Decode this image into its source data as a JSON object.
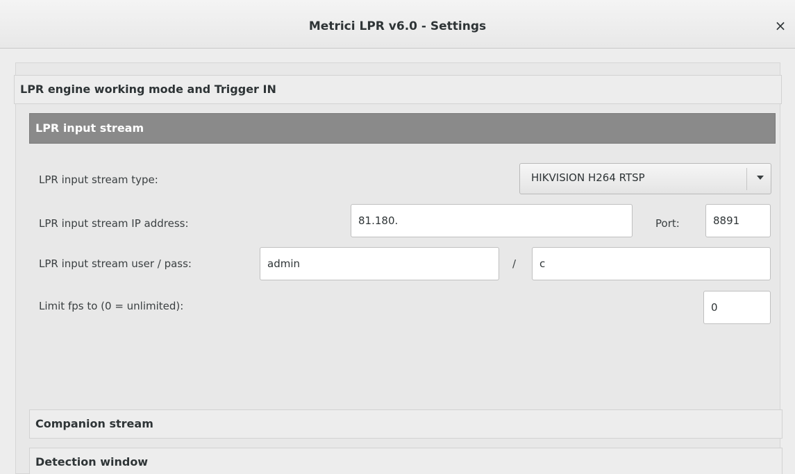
{
  "window": {
    "title": "Metrici LPR v6.0 - Settings",
    "close_symbol": "×"
  },
  "sections": {
    "trigger": {
      "label": "LPR engine working mode and Trigger IN"
    },
    "input_stream": {
      "label": "LPR input stream"
    },
    "companion": {
      "label": "Companion stream"
    },
    "detection": {
      "label": "Detection window"
    }
  },
  "input_stream": {
    "type_label": "LPR input stream type:",
    "type_value": "HIKVISION H264 RTSP",
    "ip_label": "LPR input stream IP address:",
    "ip_value": "81.180.",
    "port_label": "Port:",
    "port_value": "8891",
    "user_pass_label": "LPR input stream user / pass:",
    "user_value": "admin",
    "separator": "/",
    "pass_value": "c",
    "fps_label": "Limit fps to (0 = unlimited):",
    "fps_value": "0"
  },
  "icons": {
    "close": "close-icon",
    "dropdown": "chevron-down-icon"
  }
}
